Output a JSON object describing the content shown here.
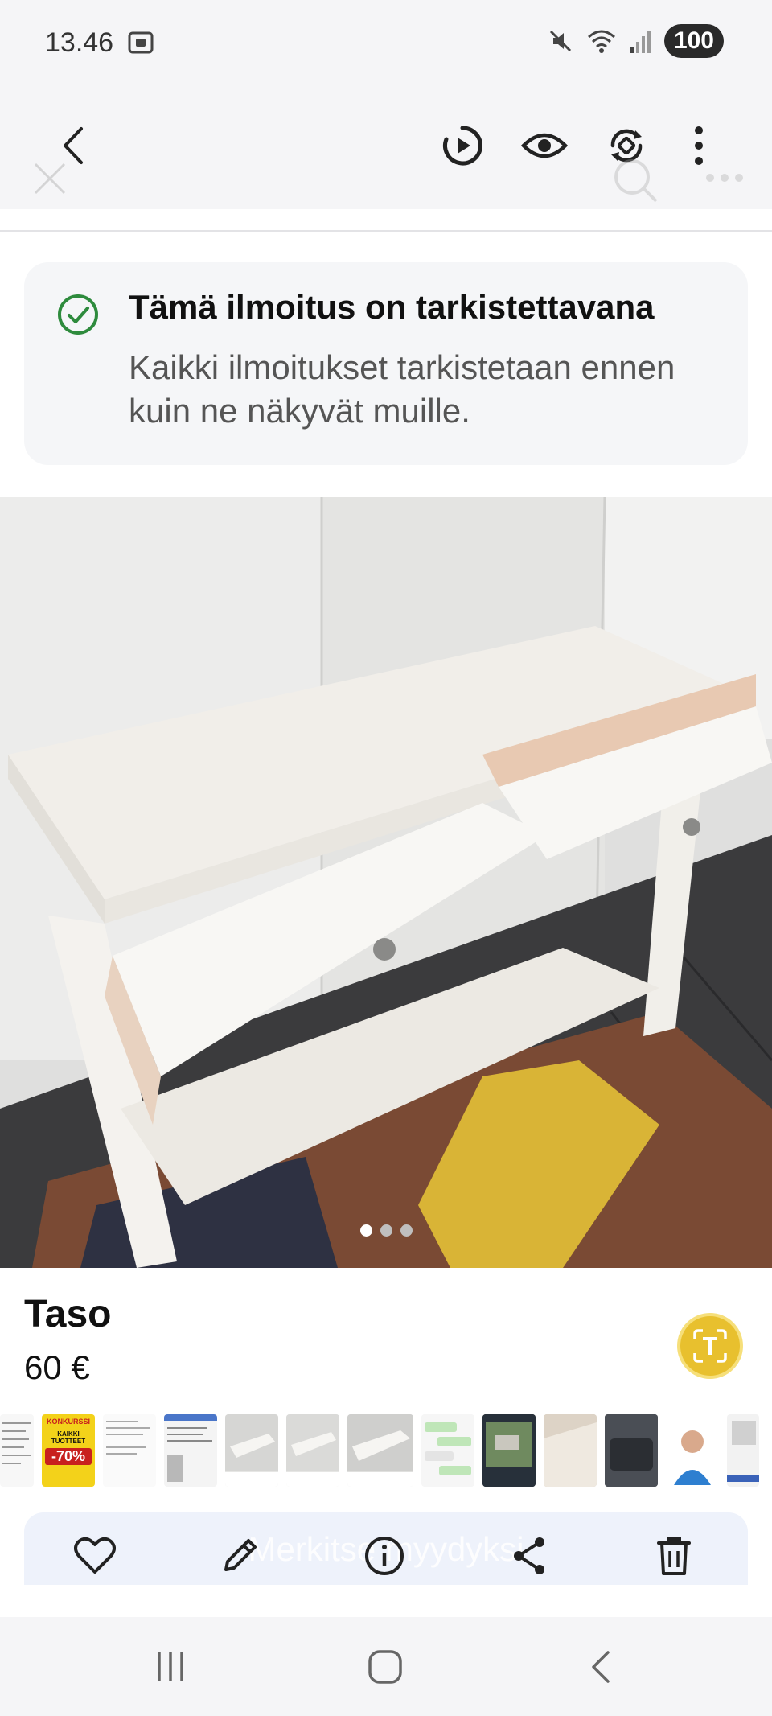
{
  "status": {
    "time": "13.46",
    "battery": "100"
  },
  "notice": {
    "title": "Tämä ilmoitus on tarkistettavana",
    "text": "Kaikki ilmoitukset tarkistetaan ennen kuin ne näkyvät muille."
  },
  "item": {
    "title": "Taso",
    "price": "60 €"
  },
  "thumbnail_promo": {
    "line1": "KONKURSSI",
    "line2": "KAIKKI TUOTTEET",
    "discount": "-70%"
  },
  "bottom": {
    "ghost_label": "Merkitse myydyksi"
  },
  "carousel": {
    "count": 3,
    "active": 0
  },
  "colors": {
    "accent_yellow": "#e8c02e",
    "check_green": "#2e8b3d"
  },
  "icons": [
    "back-arrow-icon",
    "motion-photo-icon",
    "eye-icon",
    "remaster-icon",
    "more-vertical-icon",
    "check-circle-icon",
    "text-extract-icon",
    "heart-icon",
    "pencil-icon",
    "info-icon",
    "share-icon",
    "trash-icon"
  ]
}
